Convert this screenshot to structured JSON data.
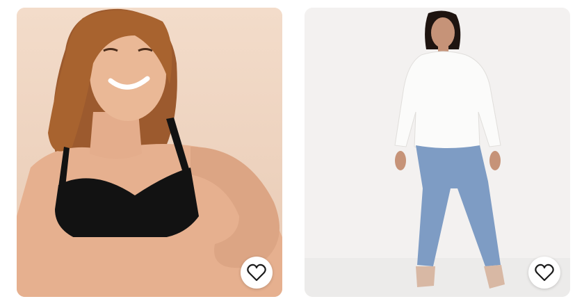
{
  "products": [
    {
      "image": "woman-black-bra-icon",
      "wishlist_icon": "heart-outline-icon",
      "background": "#efd6c2"
    },
    {
      "image": "woman-white-blouse-jeans-icon",
      "wishlist_icon": "heart-outline-icon",
      "background": "#f2f0ef"
    }
  ],
  "colors": {
    "page_background": "#ffffff",
    "button_background": "#ffffff",
    "icon_stroke": "#1a1a1a"
  }
}
